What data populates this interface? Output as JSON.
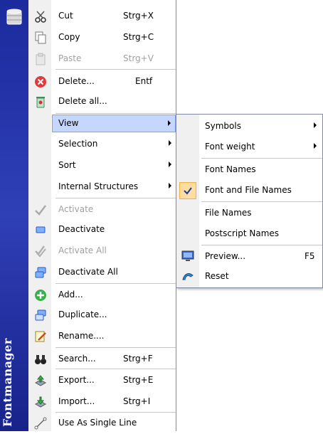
{
  "sidebar": {
    "title": "Fontmanager"
  },
  "menu": {
    "items": [
      {
        "label": "Cut",
        "shortcut": "Strg+X"
      },
      {
        "label": "Copy",
        "shortcut": "Strg+C"
      },
      {
        "label": "Paste",
        "shortcut": "Strg+V"
      },
      {
        "label": "Delete...",
        "shortcut": "Entf"
      },
      {
        "label": "Delete all..."
      },
      {
        "label": "View"
      },
      {
        "label": "Selection"
      },
      {
        "label": "Sort"
      },
      {
        "label": "Internal Structures"
      },
      {
        "label": "Activate"
      },
      {
        "label": "Deactivate"
      },
      {
        "label": "Activate All"
      },
      {
        "label": "Deactivate All"
      },
      {
        "label": "Add..."
      },
      {
        "label": "Duplicate..."
      },
      {
        "label": "Rename...."
      },
      {
        "label": "Search...",
        "shortcut": "Strg+F"
      },
      {
        "label": "Export...",
        "shortcut": "Strg+E"
      },
      {
        "label": "Import...",
        "shortcut": "Strg+I"
      },
      {
        "label": "Use As Single Line"
      }
    ]
  },
  "submenu": {
    "items": [
      {
        "label": "Symbols"
      },
      {
        "label": "Font weight"
      },
      {
        "label": "Font Names"
      },
      {
        "label": "Font and File Names"
      },
      {
        "label": "File Names"
      },
      {
        "label": "Postscript Names"
      },
      {
        "label": "Preview...",
        "shortcut": "F5"
      },
      {
        "label": "Reset"
      }
    ]
  },
  "colors": {
    "sidebar": "#1b2a9c",
    "highlight": "#c5d7ff",
    "check": "#ffdca0"
  }
}
